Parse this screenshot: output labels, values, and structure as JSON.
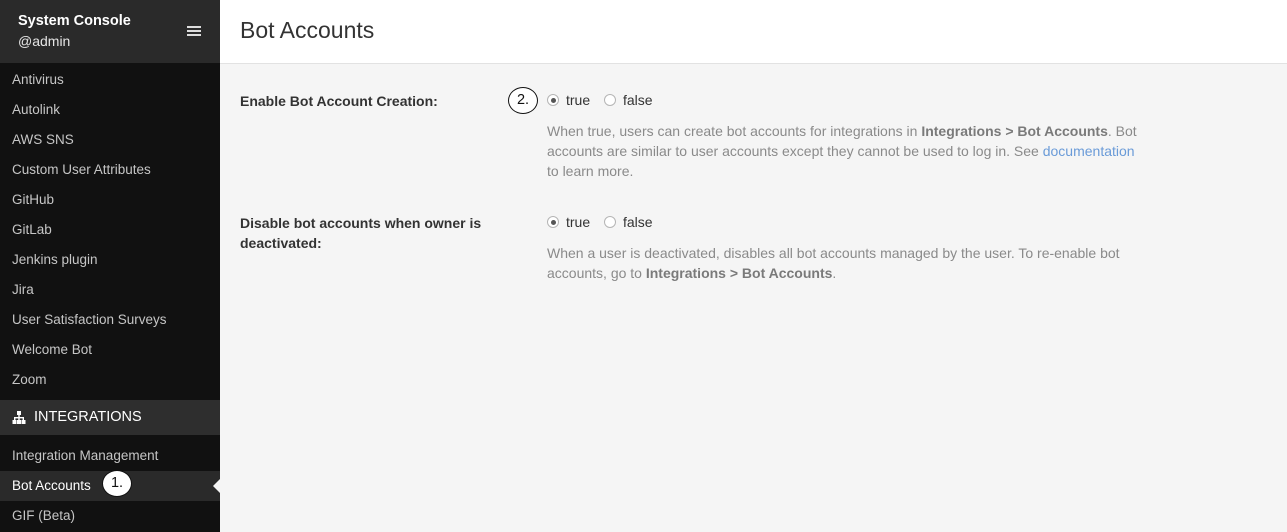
{
  "sidebar": {
    "title": "System Console",
    "user": "@admin",
    "plugins": [
      {
        "label": "Antivirus"
      },
      {
        "label": "Autolink"
      },
      {
        "label": "AWS SNS"
      },
      {
        "label": "Custom User Attributes"
      },
      {
        "label": "GitHub"
      },
      {
        "label": "GitLab"
      },
      {
        "label": "Jenkins plugin"
      },
      {
        "label": "Jira"
      },
      {
        "label": "User Satisfaction Surveys"
      },
      {
        "label": "Welcome Bot"
      },
      {
        "label": "Zoom"
      }
    ],
    "section_header": "INTEGRATIONS",
    "integrations": [
      {
        "label": "Integration Management"
      },
      {
        "label": "Bot Accounts",
        "active": true
      },
      {
        "label": "GIF (Beta)"
      }
    ]
  },
  "page": {
    "title": "Bot Accounts"
  },
  "settings": {
    "enable_creation": {
      "label": "Enable Bot Account Creation:",
      "selected": "true",
      "option_true": "true",
      "option_false": "false",
      "help": {
        "part1": "When true, users can create bot accounts for integrations in ",
        "bold1": "Integrations > Bot Accounts",
        "part2": ". Bot accounts are similar to user accounts except they cannot be used to log in. See ",
        "link": "documentation",
        "part3": " to learn more."
      }
    },
    "disable_on_deactivate": {
      "label": "Disable bot accounts when owner is deactivated:",
      "selected": "true",
      "option_true": "true",
      "option_false": "false",
      "help": {
        "part1": "When a user is deactivated, disables all bot accounts managed by the user. To re-enable bot accounts, go to ",
        "bold1": "Integrations > Bot Accounts",
        "part2": "."
      }
    }
  },
  "annotations": {
    "step1": "1.",
    "step2": "2."
  }
}
